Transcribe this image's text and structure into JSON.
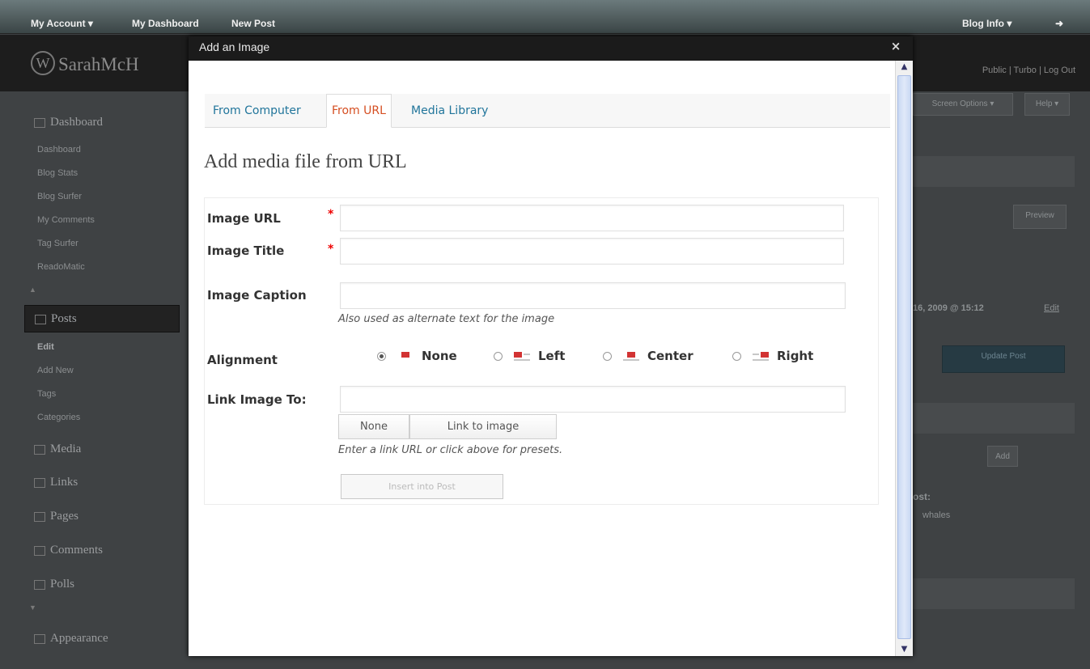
{
  "admin_bar": {
    "my_account": "My Account ▾",
    "my_dashboard": "My Dashboard",
    "new_post": "New Post",
    "blog_info": "Blog Info ▾"
  },
  "header": {
    "blog_name": "SarahMcH",
    "right_links": "Public | Turbo | Log Out"
  },
  "sidebar": {
    "dashboard": "Dashboard",
    "dashboard_items": [
      "Dashboard",
      "Blog Stats",
      "Blog Surfer",
      "My Comments",
      "Tag Surfer",
      "ReadoMatic"
    ],
    "posts": "Posts",
    "posts_items": [
      "Edit",
      "Add New",
      "Tags",
      "Categories"
    ],
    "media": "Media",
    "links": "Links",
    "pages": "Pages",
    "comments": "Comments",
    "polls": "Polls",
    "appearance": "Appearance"
  },
  "right_column": {
    "screen_options": "Screen Options ▾",
    "help": "Help ▾",
    "preview": "Preview",
    "date_text": "16, 2009 @ 15:12",
    "edit": "Edit",
    "update_post": "Update Post",
    "add": "Add",
    "post_label": "ost:",
    "whales": "whales"
  },
  "modal": {
    "title": "Add an Image",
    "close": "×",
    "tabs": [
      {
        "label": "From Computer",
        "active": false
      },
      {
        "label": "From URL",
        "active": true
      },
      {
        "label": "Media Library",
        "active": false
      }
    ],
    "heading": "Add media file from URL",
    "form": {
      "image_url_label": "Image URL",
      "image_url_value": "",
      "image_title_label": "Image Title",
      "image_title_value": "",
      "required_marker": "*",
      "image_caption_label": "Image Caption",
      "image_caption_value": "",
      "caption_help": "Also used as alternate text for the image",
      "alignment_label": "Alignment",
      "alignment_options": [
        {
          "label": "None",
          "checked": true
        },
        {
          "label": "Left",
          "checked": false
        },
        {
          "label": "Center",
          "checked": false
        },
        {
          "label": "Right",
          "checked": false
        }
      ],
      "link_label": "Link Image To:",
      "link_value": "",
      "none_button": "None",
      "link_to_image_button": "Link to image",
      "link_help": "Enter a link URL or click above for presets.",
      "insert_button": "Insert into Post"
    }
  },
  "colors": {
    "tab_link": "#21759b",
    "tab_active": "#d54e21",
    "required": "#ee0000",
    "alignment_icon": "#d23333"
  }
}
